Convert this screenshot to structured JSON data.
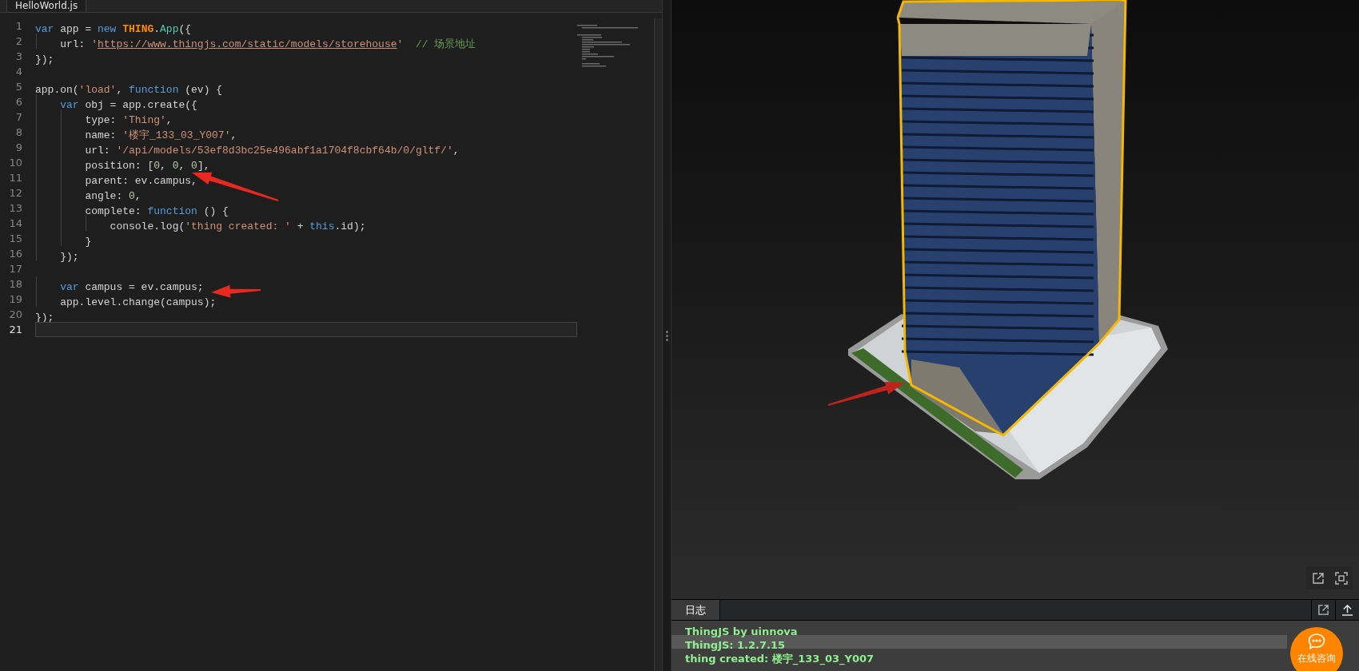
{
  "editor": {
    "tabs": [
      {
        "label": "HelloWorld.js",
        "selected": true
      }
    ],
    "lines": [
      {
        "number": "1",
        "current": false,
        "tokens": [
          {
            "kind": "keyword",
            "text": "var"
          },
          {
            "kind": "plain",
            "text": " app = "
          },
          {
            "kind": "keyword",
            "text": "new"
          },
          {
            "kind": "class",
            "text": " THING"
          },
          {
            "kind": "plain",
            "text": "."
          },
          {
            "kind": "type",
            "text": "App"
          },
          {
            "kind": "plain",
            "text": "({"
          }
        ]
      },
      {
        "number": "2",
        "current": false,
        "tokens": [
          {
            "kind": "plain",
            "text": "    url: "
          },
          {
            "kind": "string",
            "text": "'"
          },
          {
            "kind": "link",
            "text": "https://www.thingjs.com/static/models/storehouse"
          },
          {
            "kind": "string",
            "text": "'"
          },
          {
            "kind": "comment",
            "text": "  // 场景地址"
          }
        ]
      },
      {
        "number": "3",
        "current": false,
        "tokens": [
          {
            "kind": "plain",
            "text": "});"
          }
        ]
      },
      {
        "number": "4",
        "current": false
      },
      {
        "number": "5",
        "current": false,
        "tokens": [
          {
            "kind": "plain",
            "text": "app.on("
          },
          {
            "kind": "string",
            "text": "'load'"
          },
          {
            "kind": "plain",
            "text": ", "
          },
          {
            "kind": "keyword",
            "text": "function"
          },
          {
            "kind": "plain",
            "text": " (ev) {"
          }
        ]
      },
      {
        "number": "6",
        "current": false,
        "tokens": [
          {
            "kind": "keyword",
            "text": "    var"
          },
          {
            "kind": "plain",
            "text": " obj = app.create({"
          }
        ]
      },
      {
        "number": "7",
        "current": false,
        "tokens": [
          {
            "kind": "plain",
            "text": "        type: "
          },
          {
            "kind": "string",
            "text": "'Thing'"
          },
          {
            "kind": "plain",
            "text": ","
          }
        ]
      },
      {
        "number": "8",
        "current": false,
        "tokens": [
          {
            "kind": "plain",
            "text": "        name: "
          },
          {
            "kind": "string",
            "text": "'楼宇_133_03_Y007'"
          },
          {
            "kind": "plain",
            "text": ","
          }
        ]
      },
      {
        "number": "9",
        "current": false,
        "tokens": [
          {
            "kind": "plain",
            "text": "        url: "
          },
          {
            "kind": "string",
            "text": "'/api/models/53ef8d3bc25e496abf1a1704f8cbf64b/0/gltf/'"
          },
          {
            "kind": "plain",
            "text": ","
          }
        ]
      },
      {
        "number": "10",
        "current": false,
        "tokens": [
          {
            "kind": "plain",
            "text": "        position: ["
          },
          {
            "kind": "number",
            "text": "0"
          },
          {
            "kind": "plain",
            "text": ", "
          },
          {
            "kind": "number",
            "text": "0"
          },
          {
            "kind": "plain",
            "text": ", "
          },
          {
            "kind": "number",
            "text": "0"
          },
          {
            "kind": "plain",
            "text": "],"
          }
        ]
      },
      {
        "number": "11",
        "current": false,
        "tokens": [
          {
            "kind": "plain",
            "text": "        parent: ev.campus,"
          }
        ]
      },
      {
        "number": "12",
        "current": false,
        "tokens": [
          {
            "kind": "plain",
            "text": "        angle: "
          },
          {
            "kind": "number",
            "text": "0"
          },
          {
            "kind": "plain",
            "text": ","
          }
        ]
      },
      {
        "number": "13",
        "current": false,
        "tokens": [
          {
            "kind": "plain",
            "text": "        complete: "
          },
          {
            "kind": "keyword",
            "text": "function"
          },
          {
            "kind": "plain",
            "text": " () {"
          }
        ]
      },
      {
        "number": "14",
        "current": false,
        "tokens": [
          {
            "kind": "plain",
            "text": "            console.log("
          },
          {
            "kind": "string",
            "text": "'thing created: '"
          },
          {
            "kind": "plain",
            "text": " + "
          },
          {
            "kind": "keyword",
            "text": "this"
          },
          {
            "kind": "plain",
            "text": ".id);"
          }
        ]
      },
      {
        "number": "15",
        "current": false,
        "tokens": [
          {
            "kind": "plain",
            "text": "        }"
          }
        ]
      },
      {
        "number": "16",
        "current": false,
        "tokens": [
          {
            "kind": "plain",
            "text": "    });"
          }
        ]
      },
      {
        "number": "17",
        "current": false
      },
      {
        "number": "18",
        "current": false,
        "tokens": [
          {
            "kind": "keyword",
            "text": "    var"
          },
          {
            "kind": "plain",
            "text": " campus = ev.campus;"
          }
        ]
      },
      {
        "number": "19",
        "current": false,
        "tokens": [
          {
            "kind": "plain",
            "text": "    app.level.change(campus);"
          }
        ]
      },
      {
        "number": "20",
        "current": false,
        "tokens": [
          {
            "kind": "plain",
            "text": "});"
          }
        ]
      },
      {
        "number": "21",
        "current": true
      }
    ]
  },
  "log": {
    "tabs": [
      {
        "label": "日志",
        "selected": true
      }
    ],
    "lines": [
      {
        "text": "ThingJS by uinnova",
        "selected": false
      },
      {
        "text": "ThingJS: 1.2.7.15",
        "selected": true
      },
      {
        "text": "thing created: 楼宇_133_03_Y007",
        "selected": false
      }
    ]
  },
  "chat_button": {
    "label": "在线咨询"
  }
}
